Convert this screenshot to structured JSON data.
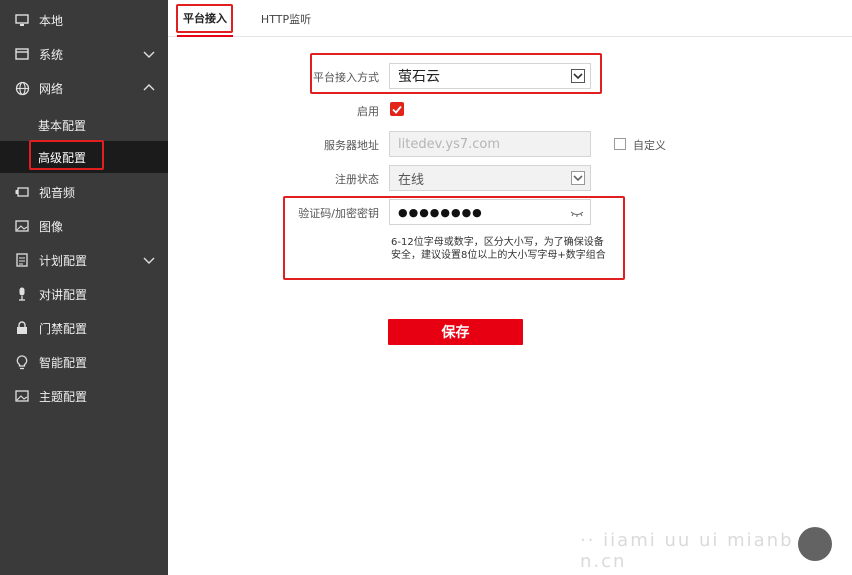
{
  "sidebar": {
    "items": [
      {
        "label": "本地",
        "icon": "monitor-icon"
      },
      {
        "label": "系统",
        "icon": "system-icon"
      },
      {
        "label": "网络",
        "icon": "globe-icon"
      },
      {
        "label": "视音频",
        "icon": "camera-icon"
      },
      {
        "label": "图像",
        "icon": "image-icon"
      },
      {
        "label": "计划配置",
        "icon": "schedule-icon"
      },
      {
        "label": "对讲配置",
        "icon": "microphone-icon"
      },
      {
        "label": "门禁配置",
        "icon": "lock-icon"
      },
      {
        "label": "智能配置",
        "icon": "bulb-icon"
      },
      {
        "label": "主题配置",
        "icon": "theme-icon"
      }
    ],
    "network_sub": [
      {
        "label": "基本配置"
      },
      {
        "label": "高级配置"
      }
    ]
  },
  "tabs": [
    {
      "label": "平台接入"
    },
    {
      "label": "HTTP监听"
    }
  ],
  "form": {
    "access_mode_label": "平台接入方式",
    "access_mode_value": "萤石云",
    "enable_label": "启用",
    "server_label": "服务器地址",
    "server_value": "litedev.ys7.com",
    "custom_label": "自定义",
    "status_label": "注册状态",
    "status_value": "在线",
    "code_label": "验证码/加密密钥",
    "code_value": "●●●●●●●●",
    "hint": "6-12位字母或数字，区分大小写，为了确保设备安全，建议设置8位以上的大小写字母+数字组合"
  },
  "save_label": "保存",
  "watermark": "·· iiami uu ui  mianb  n.cn",
  "colors": {
    "accent": "#e60012",
    "sidebar_bg": "#3a3a3a",
    "active_bg": "#1b1b1b"
  }
}
